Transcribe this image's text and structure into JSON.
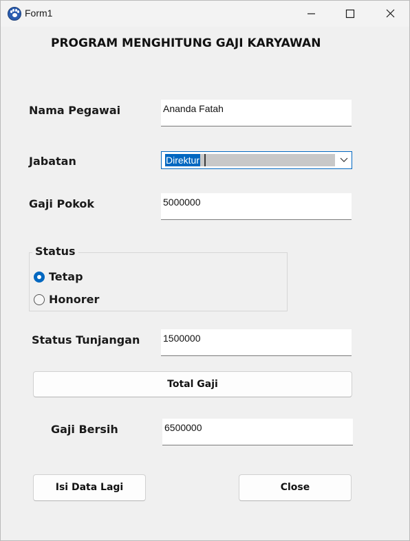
{
  "window": {
    "title": "Form1",
    "app_icon": "paw-icon"
  },
  "form": {
    "heading": "PROGRAM MENGHITUNG GAJI KARYAWAN",
    "nama_label": "Nama Pegawai",
    "nama_value": "Ananda Fatah",
    "jabatan_label": "Jabatan",
    "jabatan_value": "Direktur",
    "gaji_pokok_label": "Gaji Pokok",
    "gaji_pokok_value": "5000000",
    "status_group_title": "Status",
    "status_options": [
      {
        "label": "Tetap",
        "checked": true
      },
      {
        "label": "Honorer",
        "checked": false
      }
    ],
    "tunjangan_label": "Status Tunjangan",
    "tunjangan_value": "1500000",
    "total_button": "Total Gaji",
    "gaji_bersih_label": "Gaji Bersih",
    "gaji_bersih_value": "6500000",
    "isi_data_button": "Isi Data Lagi",
    "close_button": "Close"
  },
  "colors": {
    "accent": "#0067c0",
    "background": "#f0f0f0"
  }
}
